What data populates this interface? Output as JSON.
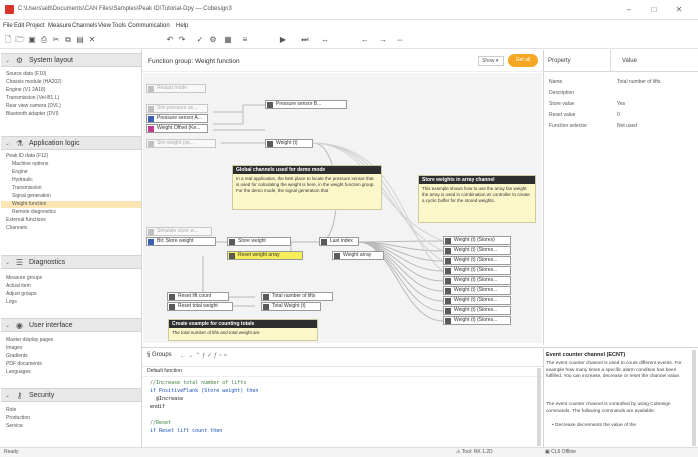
{
  "window": {
    "title": "C:\\Users\\ai8\\Documents\\CAN Files\\Samples\\Peak ID\\Tutorial-Dpy — Cobesign3",
    "minimize": "–",
    "maximize": "□",
    "close": "✕"
  },
  "menu": [
    "File",
    "Edit",
    "Project",
    "Measure",
    "Channels",
    "View",
    "Tools",
    "Communication",
    "Help"
  ],
  "sidebar": {
    "system_layout": {
      "label": "System layout",
      "items": [
        "Source data (F10)",
        "Chassis module (HA202)",
        "Engine (V1 2A18)",
        "Transmission (Vel-B1 L)",
        "Rear view camera (DVL)",
        "Bluetooth adapter (DVI)"
      ]
    },
    "application_logic": {
      "label": "Application logic",
      "items": [
        "Peak ID data (F12)",
        "Machine options",
        "Engine",
        "Hydraulic",
        "Transmission",
        "Signal generation",
        "Weight function",
        "Remote diagnostics",
        "External functions",
        "Channels"
      ],
      "selected": "Weight function"
    },
    "diagnostics": {
      "label": "Diagnostics",
      "items": [
        "Measure groups",
        "Actual item",
        "Adjust groups",
        "Logs"
      ]
    },
    "user_interface": {
      "label": "User interface",
      "items": [
        "Master display pages",
        "Images",
        "Gradients",
        "PDF documents",
        "Languages"
      ]
    },
    "security": {
      "label": "Security",
      "items": [
        "Role",
        "Production",
        "Service"
      ]
    }
  },
  "canvas": {
    "title": "Function group: Weight function",
    "zoom": "Show ▾",
    "action_button": "Get all",
    "blocks": {
      "input_reset": "Restart mode",
      "sim_pressure": "Sim pressure se...",
      "pressure_sensor_a": "Pressure sensor A...",
      "weight_offset": "Weight Offset (Ke...",
      "sim_weight": "Sim weight (sp...",
      "pressure_sensor_b": "Pressure sensor B...",
      "weight_kt": "Weight (t)",
      "sim_store": "Simulate store w...",
      "bit_store_weight": "Bit: Store weight",
      "store_weight": "Store weight",
      "last_index": "Last index",
      "reset_weight_array": "Reset weight array",
      "weight_array": "Weight array",
      "reset_lift_count": "Reset lift count",
      "reset_total_weight": "Reset total weight",
      "total_lifts": "Total number of lifts",
      "total_weight": "Total Weight (t)",
      "weight_outputs": [
        "Weight (t) (Stores)",
        "Weight (t) (Stores...",
        "Weight (t) (Stores...",
        "Weight (t) (Stores...",
        "Weight (t) (Stores...",
        "Weight (t) (Stores...",
        "Weight (t) (Stores...",
        "Weight (t) (Stores...",
        "Weight (t) (Stores..."
      ]
    },
    "notes": {
      "global": {
        "head": "Global channels used for demo mode",
        "body": "In a real application, the best place to locate the pressure sensor that is used for calculating the weight is here, in the weight function group. For the demo mode, the signal generation that"
      },
      "array": {
        "head": "Store weights in array channel",
        "body": "This example shows how to use the array fan weight the array is used in combination w/ controller to create a cyclic buffer for the stored weights."
      },
      "counting": {
        "head": "Create example for counting totals",
        "body": "The total number of lifts and total weight are"
      }
    }
  },
  "properties": {
    "col_property": "Property",
    "col_value": "Value",
    "rows": [
      {
        "name": "Name",
        "value": "Total number of lifts"
      },
      {
        "name": "Description",
        "value": ""
      },
      {
        "name": "Store value",
        "value": "Yes"
      },
      {
        "name": "Reset value",
        "value": "0"
      },
      {
        "name": "Function selector",
        "value": "Not used"
      }
    ]
  },
  "editor": {
    "tab": "§ Groups",
    "tab_tools": "← → ⌃ ƒ ✓ ƒ ~ ≈",
    "subtitle": "Default function",
    "lines": [
      {
        "cls": "cm",
        "text": "//Increase total number of lifts"
      },
      {
        "cls": "kw",
        "text": "if PositiveFlank (Store weight) then"
      },
      {
        "cls": "tx",
        "text": "  @Increase"
      },
      {
        "cls": "tx",
        "text": "endif"
      },
      {
        "cls": "tx",
        "text": ""
      },
      {
        "cls": "cm",
        "text": "//Reset"
      },
      {
        "cls": "kw",
        "text": "if Reset lift count then"
      }
    ]
  },
  "help": {
    "title": "Event counter channel (ECNT)",
    "paragraphs": [
      "The event counter channel is used to count different events. For example how many times a specific alarm condition has been fulfilled. You can increase, decrease or reset the channel value.",
      "The event counter channel is controlled by using Cobesign commands. The following commands are available:",
      "• Decrease decrements the value of the"
    ]
  },
  "status": {
    "left": "Ready",
    "mid1": "⚠ Tool: RK 1.2D",
    "mid2": "▣ CL6 Offline"
  }
}
